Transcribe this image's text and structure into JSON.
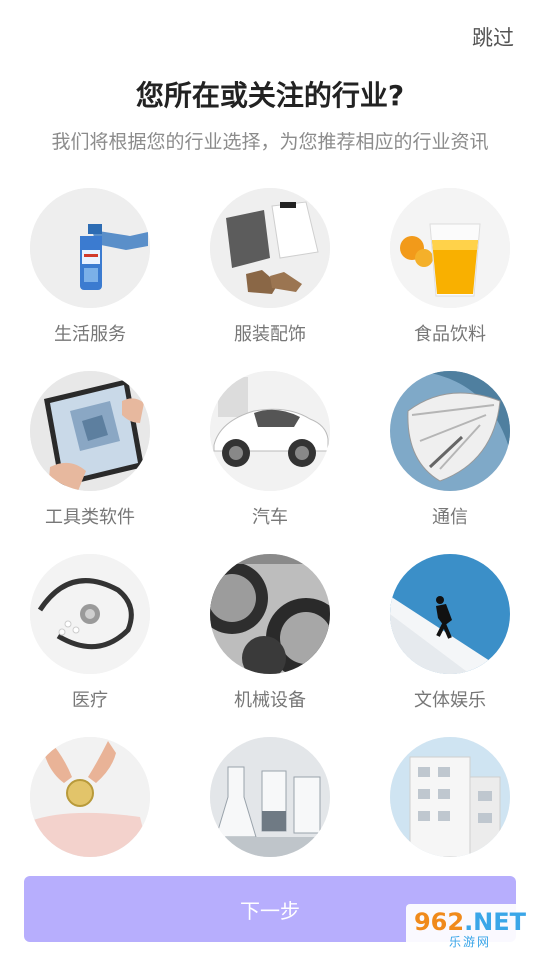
{
  "header": {
    "skip_label": "跳过"
  },
  "intro": {
    "title": "您所在或关注的行业?",
    "subtitle": "我们将根据您的行业选择，为您推荐相应的行业资讯"
  },
  "industries": [
    {
      "label": "生活服务",
      "icon": "cleaning-spray-icon"
    },
    {
      "label": "服装配饰",
      "icon": "clothes-shoes-icon"
    },
    {
      "label": "食品饮料",
      "icon": "juice-glass-icon"
    },
    {
      "label": "工具类软件",
      "icon": "tablet-drawing-icon"
    },
    {
      "label": "汽车",
      "icon": "sports-car-icon"
    },
    {
      "label": "通信",
      "icon": "satellite-dish-icon"
    },
    {
      "label": "医疗",
      "icon": "stethoscope-icon"
    },
    {
      "label": "机械设备",
      "icon": "gears-icon"
    },
    {
      "label": "文体娱乐",
      "icon": "skier-icon"
    },
    {
      "label": "",
      "icon": "piggy-bank-coin-icon"
    },
    {
      "label": "",
      "icon": "lab-glassware-icon"
    },
    {
      "label": "",
      "icon": "white-building-icon"
    }
  ],
  "footer": {
    "next_label": "下一步"
  },
  "watermark": {
    "top_a": "962",
    "top_b": ".NET",
    "bottom": "乐游网"
  },
  "colors": {
    "accent": "#b7aefd",
    "title": "#222222",
    "subtitle": "#8c8c8c"
  }
}
